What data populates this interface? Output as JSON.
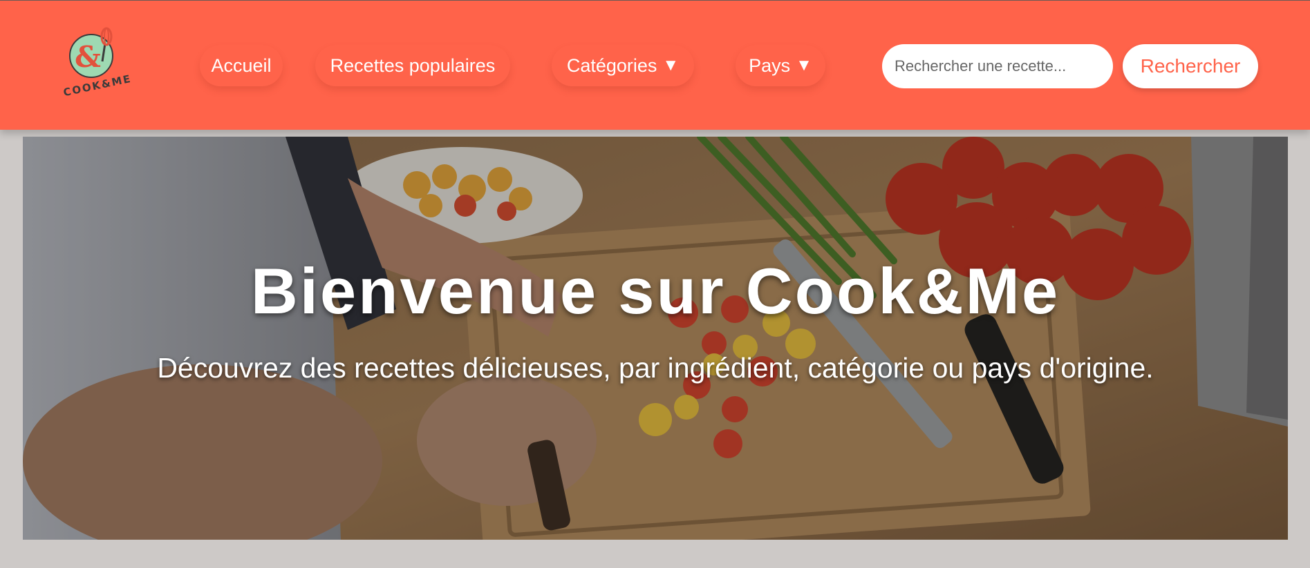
{
  "header": {
    "logo_text": "COOK&ME",
    "nav": [
      {
        "label": "Accueil",
        "has_dropdown": false
      },
      {
        "label": "Recettes populaires",
        "has_dropdown": false
      },
      {
        "label": "Catégories",
        "has_dropdown": true
      },
      {
        "label": "Pays",
        "has_dropdown": true
      }
    ],
    "dropdown_glyph": "▼",
    "search": {
      "placeholder": "Rechercher une recette...",
      "value": "",
      "button_label": "Rechercher"
    }
  },
  "hero": {
    "title": "Bienvenue sur Cook&Me",
    "subtitle": "Découvrez des recettes délicieuses, par ingrédient, catégorie ou pays d'origine.",
    "background_image": "kitchen-cutting-tomatoes-photo"
  },
  "colors": {
    "brand": "#ff634a",
    "page_background": "#cdc9c7",
    "logo_accent": "#9ed9b2"
  },
  "icons": [
    "logo-whisk-ampersand-icon",
    "chevron-down-icon"
  ]
}
